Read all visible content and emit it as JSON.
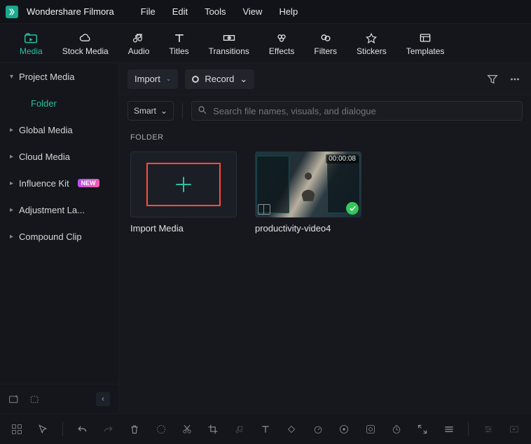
{
  "app": {
    "title": "Wondershare Filmora"
  },
  "menus": [
    "File",
    "Edit",
    "Tools",
    "View",
    "Help"
  ],
  "tools": [
    {
      "key": "media",
      "label": "Media",
      "active": true
    },
    {
      "key": "stock",
      "label": "Stock Media"
    },
    {
      "key": "audio",
      "label": "Audio"
    },
    {
      "key": "titles",
      "label": "Titles"
    },
    {
      "key": "transitions",
      "label": "Transitions"
    },
    {
      "key": "effects",
      "label": "Effects"
    },
    {
      "key": "filters",
      "label": "Filters"
    },
    {
      "key": "stickers",
      "label": "Stickers"
    },
    {
      "key": "templates",
      "label": "Templates"
    }
  ],
  "sidebar": {
    "items": [
      {
        "label": "Project Media",
        "expandable": true,
        "open": true
      },
      {
        "label": "Folder",
        "indent": true,
        "selected": true
      },
      {
        "label": "Global Media",
        "expandable": true
      },
      {
        "label": "Cloud Media",
        "expandable": true
      },
      {
        "label": "Influence Kit",
        "expandable": true,
        "new": true
      },
      {
        "label": "Adjustment La...",
        "expandable": true
      },
      {
        "label": "Compound Clip",
        "expandable": true
      }
    ]
  },
  "actionbar": {
    "import_label": "Import",
    "record_label": "Record"
  },
  "search": {
    "smart_label": "Smart",
    "placeholder": "Search file names, visuals, and dialogue"
  },
  "crumb": "FOLDER",
  "cards": {
    "import": {
      "label": "Import Media"
    },
    "clip1": {
      "label": "productivity-video4",
      "duration": "00:00:08"
    }
  }
}
